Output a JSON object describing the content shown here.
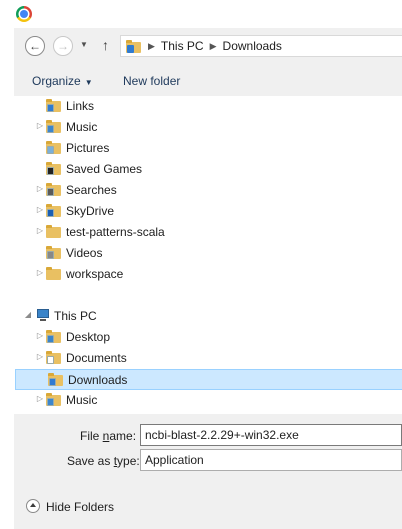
{
  "titlebar": {
    "icon": "chrome-logo-icon"
  },
  "nav": {
    "back_icon": "back-arrow-icon",
    "forward_icon": "forward-arrow-icon",
    "recent_icon": "chevron-down-icon",
    "up_icon": "up-arrow-icon",
    "breadcrumbs": [
      "This PC",
      "Downloads"
    ]
  },
  "toolbar": {
    "organize_label": "Organize",
    "new_folder_label": "New folder"
  },
  "tree": [
    {
      "label": "Links",
      "icon": "links-folder-icon",
      "expandable": false,
      "badge": "#2f7bd1"
    },
    {
      "label": "Music",
      "icon": "music-folder-icon",
      "expandable": true,
      "badge": "#3d86cc"
    },
    {
      "label": "Pictures",
      "icon": "pictures-folder-icon",
      "expandable": false,
      "badge": "#7bb0d9"
    },
    {
      "label": "Saved Games",
      "icon": "saved-games-folder-icon",
      "expandable": false,
      "badge": "#222222"
    },
    {
      "label": "Searches",
      "icon": "searches-folder-icon",
      "expandable": true,
      "badge": "#5a5a5a"
    },
    {
      "label": "SkyDrive",
      "icon": "skydrive-folder-icon",
      "expandable": true,
      "badge": "#1a5fb4"
    },
    {
      "label": "test-patterns-scala",
      "icon": "folder-icon",
      "expandable": true,
      "badge": ""
    },
    {
      "label": "Videos",
      "icon": "videos-folder-icon",
      "expandable": false,
      "badge": "#888888"
    },
    {
      "label": "workspace",
      "icon": "folder-icon",
      "expandable": true,
      "badge": ""
    },
    {
      "label": "This PC",
      "icon": "computer-icon",
      "expandable": true,
      "expanded": true,
      "root": true
    },
    {
      "label": "Desktop",
      "icon": "desktop-folder-icon",
      "expandable": true,
      "badge": "#3a84c9"
    },
    {
      "label": "Documents",
      "icon": "documents-folder-icon",
      "expandable": true,
      "badge": "#ffffff"
    },
    {
      "label": "Downloads",
      "icon": "downloads-folder-icon",
      "expandable": false,
      "badge": "#2f7bd1",
      "selected": true
    },
    {
      "label": "Music",
      "icon": "music-folder-icon",
      "expandable": true,
      "badge": "#3d86cc"
    }
  ],
  "fields": {
    "file_name_label_pre": "File ",
    "file_name_label_key": "n",
    "file_name_label_post": "ame:",
    "file_name_value": "ncbi-blast-2.2.29+-win32.exe",
    "save_type_label_pre": "Save as ",
    "save_type_label_key": "t",
    "save_type_label_post": "ype:",
    "save_type_value": "Application"
  },
  "footer": {
    "hide_folders_label": "Hide Folders",
    "hide_icon": "collapse-up-icon"
  }
}
